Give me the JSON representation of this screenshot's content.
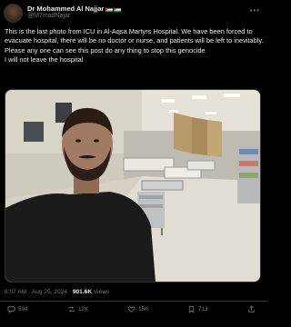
{
  "author": {
    "display_name": "Dr Mohammed Al Najjar",
    "handle": "@M7madNajar"
  },
  "tweet": {
    "text": "This is the last photo from ICU in Al-Aqsa Martyrs Hospital.  We have been forced to evacuate hospital, there will be no doctor or nurse, and patients will be left to inevitably.\nPlease any one can see this post do any thing to stop this genocide\nI will not leave the hospital",
    "time": "8:07 AM",
    "date": "Aug 25, 2024",
    "views_count": "901.6K",
    "views_label": "Views"
  },
  "actions": {
    "replies": "594",
    "reposts": "12K",
    "likes": "15K",
    "bookmarks": "713"
  },
  "colors": {
    "background": "#000000",
    "text": "#e7e9ea",
    "muted": "#71767b",
    "border": "#2f3336"
  }
}
